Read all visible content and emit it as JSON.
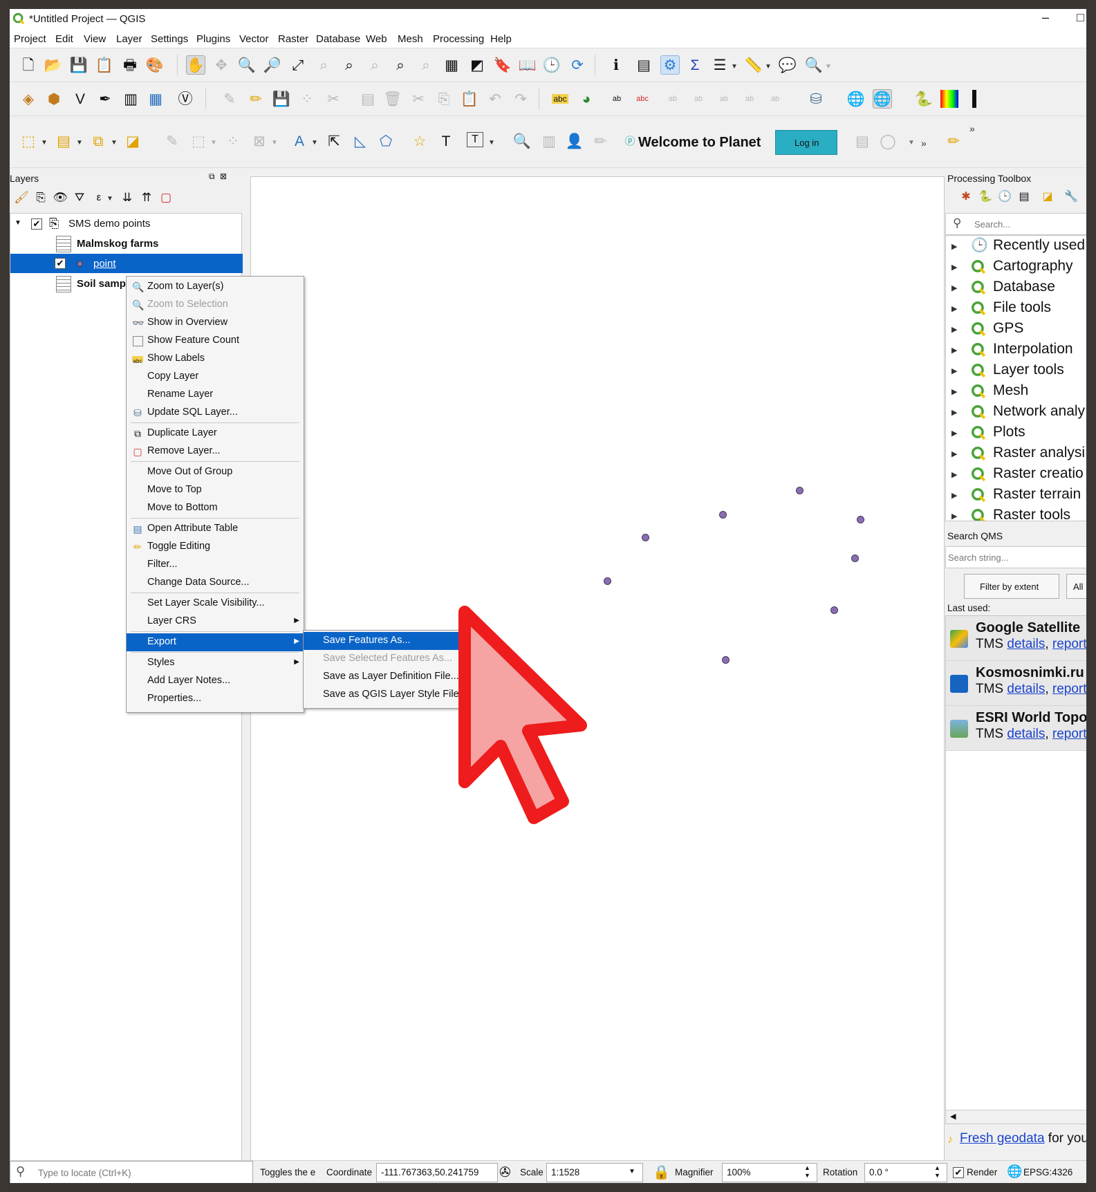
{
  "window": {
    "title": "*Untitled Project — QGIS",
    "minimize": "–",
    "maximize": "□"
  },
  "menubar": [
    "Project",
    "Edit",
    "View",
    "Layer",
    "Settings",
    "Plugins",
    "Vector",
    "Raster",
    "Database",
    "Web",
    "Mesh",
    "Processing",
    "Help"
  ],
  "planet": {
    "welcome": "Welcome to Planet",
    "login": "Log in"
  },
  "layers_panel": {
    "title": "Layers",
    "layers": [
      {
        "label": "SMS demo points",
        "checked": true,
        "kind": "group"
      },
      {
        "label": "Malmskog farms",
        "bold": true,
        "kind": "table"
      },
      {
        "label": "point",
        "checked": true,
        "selected": true,
        "kind": "point"
      },
      {
        "label": "Soil samp",
        "bold": true,
        "kind": "table"
      }
    ]
  },
  "context_menu": {
    "items": [
      {
        "label": "Zoom to Layer(s)",
        "icon": "zoom-icon"
      },
      {
        "label": "Zoom to Selection",
        "icon": "zoom-selection-icon",
        "disabled": true
      },
      {
        "label": "Show in Overview",
        "icon": "overview-icon"
      },
      {
        "label": "Show Feature Count",
        "icon": "checkbox-icon"
      },
      {
        "label": "Show Labels",
        "icon": "labels-icon"
      },
      {
        "label": "Copy Layer"
      },
      {
        "label": "Rename Layer"
      },
      {
        "label": "Update SQL Layer...",
        "icon": "database-icon"
      },
      {
        "label": "Duplicate Layer",
        "icon": "duplicate-icon"
      },
      {
        "label": "Remove Layer...",
        "icon": "remove-icon"
      },
      {
        "label": "Move Out of Group"
      },
      {
        "label": "Move to Top"
      },
      {
        "label": "Move to Bottom"
      },
      {
        "label": "Open Attribute Table",
        "icon": "table-icon"
      },
      {
        "label": "Toggle Editing",
        "icon": "pencil-icon"
      },
      {
        "label": "Filter..."
      },
      {
        "label": "Change Data Source..."
      },
      {
        "label": "Set Layer Scale Visibility..."
      },
      {
        "label": "Layer CRS",
        "submenu": true
      },
      {
        "label": "Export",
        "submenu": true,
        "highlighted": true
      },
      {
        "label": "Styles",
        "submenu": true
      },
      {
        "label": "Add Layer Notes..."
      },
      {
        "label": "Properties..."
      }
    ],
    "export_submenu": [
      {
        "label": "Save Features As...",
        "highlighted": true
      },
      {
        "label": "Save Selected Features As...",
        "disabled": true
      },
      {
        "label": "Save as Layer Definition File..."
      },
      {
        "label": "Save as QGIS Layer Style File..."
      }
    ]
  },
  "toolbox": {
    "title": "Processing Toolbox",
    "search_placeholder": "Search...",
    "items": [
      "Recently used",
      "Cartography",
      "Database",
      "File tools",
      "GPS",
      "Interpolation",
      "Layer tools",
      "Mesh",
      "Network analy",
      "Plots",
      "Raster analysi",
      "Raster creatio",
      "Raster terrain",
      "Raster tools"
    ]
  },
  "qms": {
    "title": "Search QMS",
    "search_placeholder": "Search string...",
    "filter_button": "Filter by extent",
    "all_button": "All",
    "last_used": "Last used:",
    "services": [
      {
        "name": "Google Satellite",
        "type": "TMS",
        "details": "details",
        "report": "report",
        "icon": "google-maps-icon"
      },
      {
        "name": "Kosmosnimki.ru",
        "type": "TMS",
        "details": "details",
        "report": "report",
        "icon": "kosmosnimki-icon"
      },
      {
        "name": "ESRI World Topo",
        "type": "TMS",
        "details": "details",
        "report": "report",
        "icon": "esri-icon"
      }
    ],
    "fresh_link": "Fresh geodata",
    "fresh_text": " for you"
  },
  "statusbar": {
    "locate_placeholder": "Type to locate (Ctrl+K)",
    "toggles": "Toggles the ec",
    "coordinate_label": "Coordinate",
    "coordinate_value": "-111.767363,50.241759",
    "scale_label": "Scale",
    "scale_value": "1:1528",
    "magnifier_label": "Magnifier",
    "magnifier_value": "100%",
    "rotation_label": "Rotation",
    "rotation_value": "0.0 °",
    "render_label": "Render",
    "crs": "EPSG:4326"
  },
  "colors": {
    "accent": "#0a64c8",
    "planet_button": "#2aaec3",
    "qgis_green": "#4aa338",
    "cursor_red": "#ee1c1c",
    "cursor_fill": "#f6a3a3",
    "point_fill": "#8a6fb0"
  }
}
